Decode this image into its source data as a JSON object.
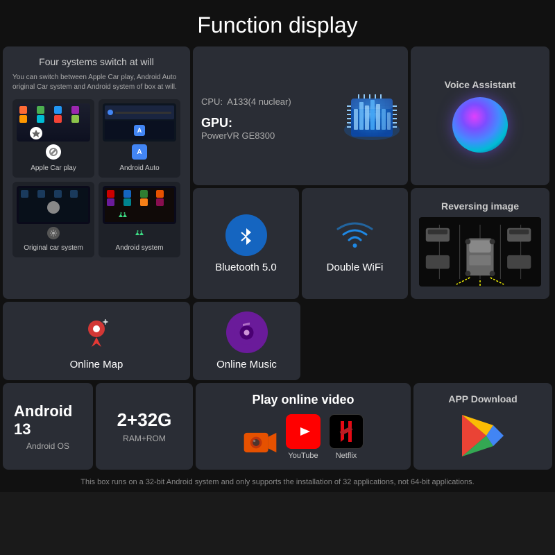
{
  "page": {
    "title": "Function display"
  },
  "four_systems": {
    "heading": "Four systems switch at will",
    "description": "You can switch between Apple Car play, Android Auto original Car system and Android system of box at will.",
    "systems": [
      {
        "label": "Apple Car play",
        "type": "carplay"
      },
      {
        "label": "Android Auto",
        "type": "android_auto"
      },
      {
        "label": "Original car system",
        "type": "original"
      },
      {
        "label": "Android system",
        "type": "android_sys"
      }
    ]
  },
  "cpu": {
    "label": "CPU:",
    "model": "A133(4 nuclear)",
    "gpu_label": "GPU:",
    "gpu_model": "PowerVR GE8300"
  },
  "voice_assistant": {
    "label": "Voice Assistant"
  },
  "bluetooth": {
    "label": "Bluetooth 5.0"
  },
  "wifi": {
    "label": "Double WiFi"
  },
  "online_map": {
    "label": "Online Map"
  },
  "online_music": {
    "label": "Online Music"
  },
  "reversing_image": {
    "label": "Reversing image"
  },
  "android": {
    "version": "Android 13",
    "os_label": "Android OS",
    "ram": "2+32G",
    "ram_label": "RAM+ROM"
  },
  "online_video": {
    "heading": "Play online video",
    "apps": [
      {
        "label": "",
        "type": "camera"
      },
      {
        "label": "YouTube",
        "type": "youtube"
      },
      {
        "label": "Netflix",
        "type": "netflix"
      }
    ]
  },
  "app_download": {
    "label": "APP Download"
  },
  "footer": {
    "text": "This box runs on a 32-bit Android system and only supports the installation of 32 applications, not 64-bit applications."
  }
}
